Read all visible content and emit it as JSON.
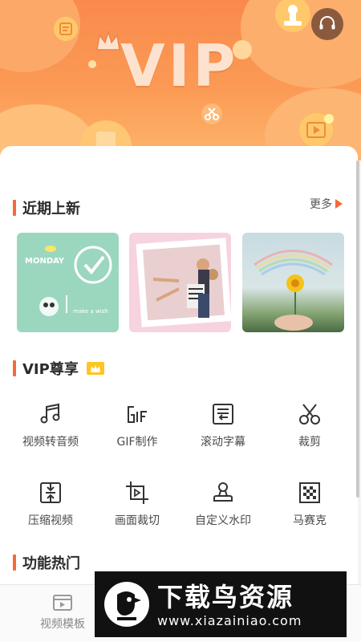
{
  "banner": {
    "title": "VIP",
    "colors": {
      "top": "#f98a4c",
      "bottom": "#fdb56c"
    }
  },
  "sections": {
    "recent": {
      "title": "近期上新",
      "more_label": "更多"
    },
    "vip": {
      "title": "VIP尊享"
    },
    "hot": {
      "title": "功能热门"
    }
  },
  "thumbnails": [
    {
      "name": "monday-sticker-template",
      "text": "MONDAY"
    },
    {
      "name": "couple-photo-template"
    },
    {
      "name": "rainbow-flower-template"
    }
  ],
  "tools": [
    {
      "label": "视频转音频",
      "icon": "music-note-icon"
    },
    {
      "label": "GIF制作",
      "icon": "gif-icon"
    },
    {
      "label": "滚动字幕",
      "icon": "scroll-subtitle-icon"
    },
    {
      "label": "裁剪",
      "icon": "scissors-icon"
    },
    {
      "label": "压缩视频",
      "icon": "compress-icon"
    },
    {
      "label": "画面裁切",
      "icon": "crop-icon"
    },
    {
      "label": "自定义水印",
      "icon": "stamp-icon"
    },
    {
      "label": "马赛克",
      "icon": "mosaic-icon"
    }
  ],
  "bottom_nav": {
    "items": [
      {
        "label": "视频模板",
        "icon": "video-template-icon"
      }
    ]
  },
  "watermark": {
    "brand_cn": "下载鸟资源",
    "url": "www.xiazainiao.com"
  },
  "accent": "#f56a3a"
}
